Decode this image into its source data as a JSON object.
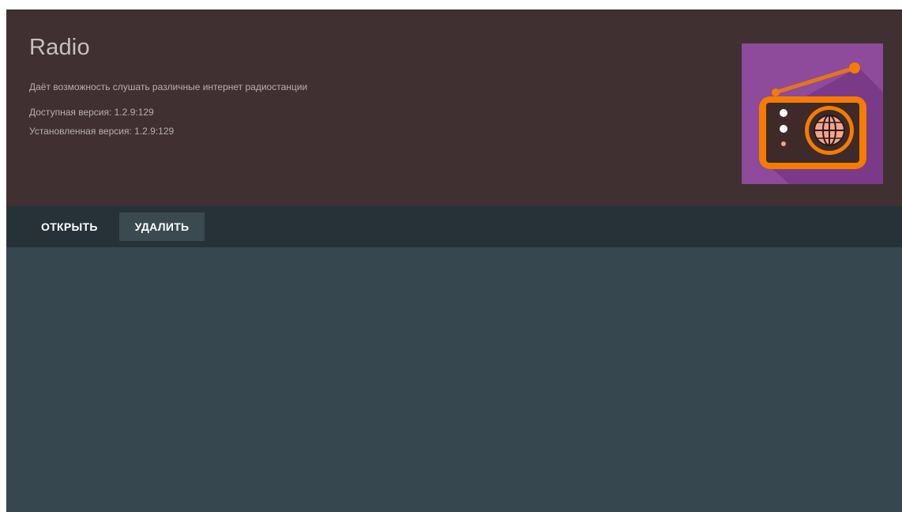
{
  "app": {
    "title": "Radio",
    "description": "Даёт возможность слушать различные интернет радиостанции",
    "available_version_label": "Доступная версия",
    "available_version": "1.2.9:129",
    "installed_version_label": "Установленная версия",
    "installed_version": "1.2.9:129",
    "icon": "radio-globe-icon"
  },
  "actions": {
    "open_label": "ОТКРЫТЬ",
    "delete_label": "УДАЛИТЬ",
    "focused": "delete"
  },
  "colors": {
    "header_bg": "#403031",
    "actions_bar_bg": "#263238",
    "content_bg": "#37474f",
    "focused_button_bg": "#3b4a51",
    "icon_bg": "#8e4a9b",
    "icon_accent": "#f57c00"
  }
}
